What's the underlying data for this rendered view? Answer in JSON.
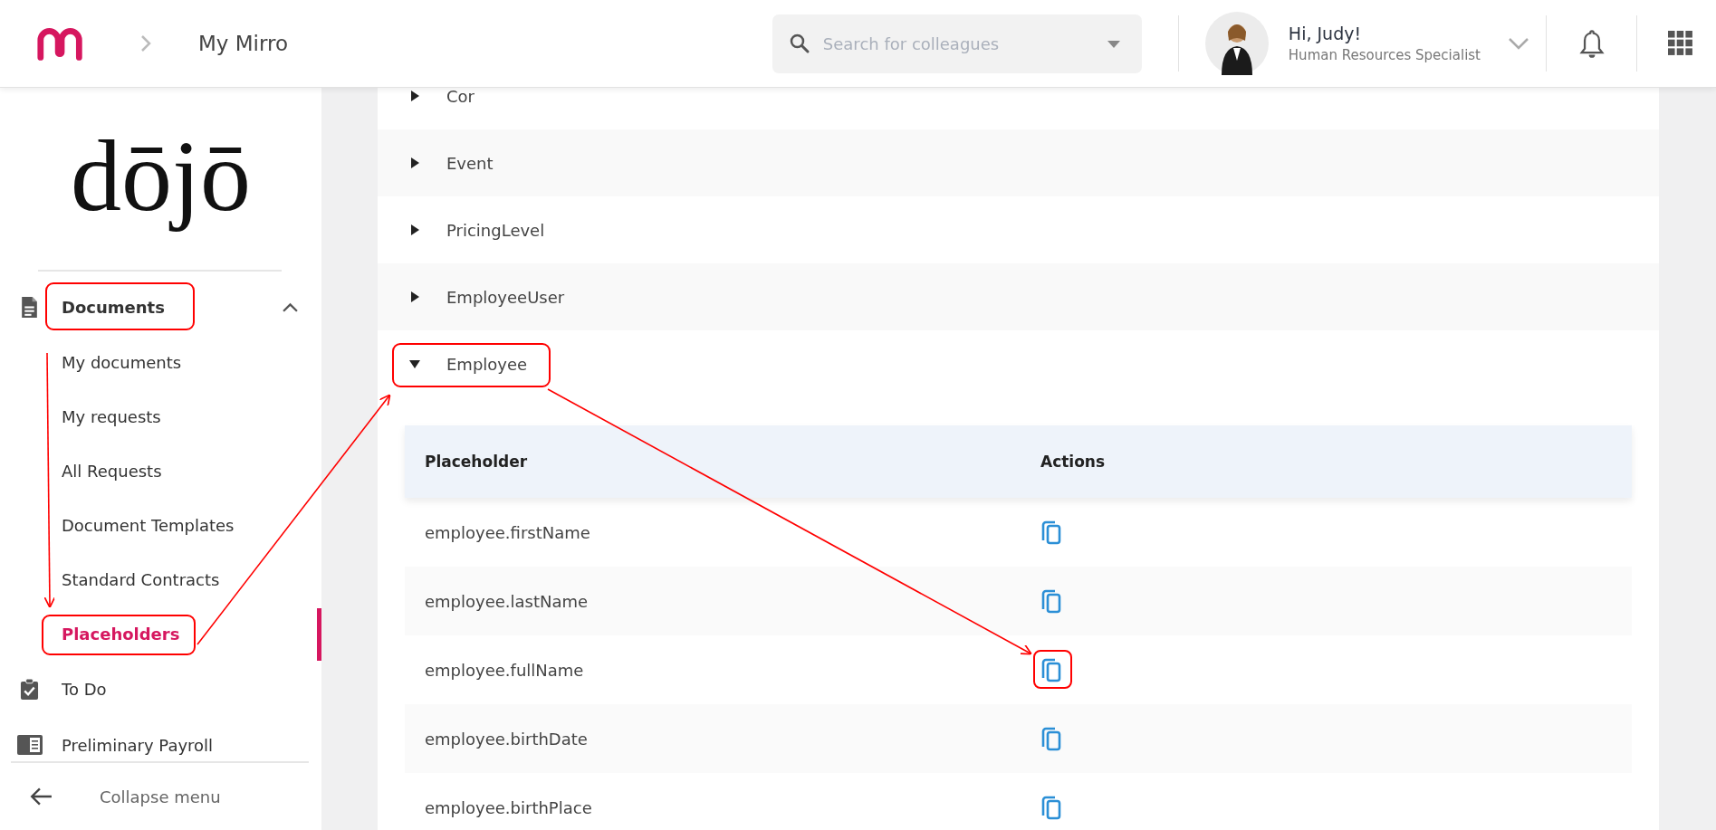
{
  "header": {
    "breadcrumb": "My Mirro",
    "search": {
      "placeholder": "Search for colleagues"
    },
    "user": {
      "greeting": "Hi, Judy!",
      "role": "Human Resources Specialist"
    }
  },
  "sidebar": {
    "logo": "dōjō",
    "items": [
      {
        "label": "Documents",
        "kind": "group",
        "expanded": true,
        "children": [
          {
            "label": "My documents",
            "selected": false
          },
          {
            "label": "My requests",
            "selected": false
          },
          {
            "label": "All Requests",
            "selected": false
          },
          {
            "label": "Document Templates",
            "selected": false
          },
          {
            "label": "Standard Contracts",
            "selected": false
          },
          {
            "label": "Placeholders",
            "selected": true
          }
        ]
      },
      {
        "label": "To Do",
        "kind": "link"
      },
      {
        "label": "Preliminary Payroll",
        "kind": "link"
      }
    ],
    "collapse_label": "Collapse menu"
  },
  "groups": [
    {
      "name": "Cor",
      "expanded": false
    },
    {
      "name": "Event",
      "expanded": false
    },
    {
      "name": "PricingLevel",
      "expanded": false
    },
    {
      "name": "EmployeeUser",
      "expanded": false
    },
    {
      "name": "Employee",
      "expanded": true,
      "table": {
        "columns": [
          "Placeholder",
          "Actions"
        ],
        "rows": [
          {
            "placeholder": "employee.firstName"
          },
          {
            "placeholder": "employee.lastName"
          },
          {
            "placeholder": "employee.fullName"
          },
          {
            "placeholder": "employee.birthDate"
          },
          {
            "placeholder": "employee.birthPlace"
          }
        ]
      }
    }
  ]
}
